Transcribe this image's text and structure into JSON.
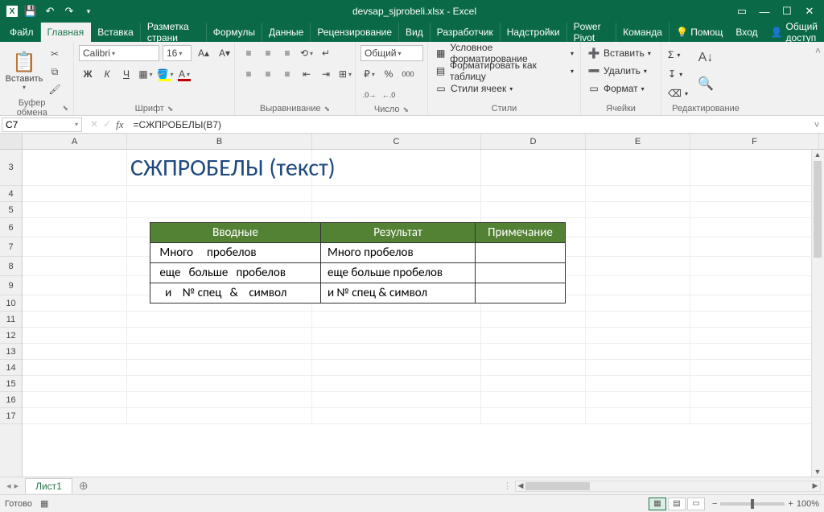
{
  "window": {
    "title": "devsap_sjprobeli.xlsx - Excel"
  },
  "qat": [
    "save",
    "undo",
    "redo",
    "reserved"
  ],
  "tabs": {
    "items": [
      "Файл",
      "Главная",
      "Вставка",
      "Разметка страни",
      "Формулы",
      "Данные",
      "Рецензирование",
      "Вид",
      "Разработчик",
      "Надстройки",
      "Power Pivot",
      "Команда"
    ],
    "active_index": 1,
    "help": "Помощ",
    "signin": "Вход",
    "share": "Общий доступ"
  },
  "ribbon": {
    "clipboard": {
      "title": "Буфер обмена",
      "paste": "Вставить"
    },
    "font": {
      "title": "Шрифт",
      "name": "Calibri",
      "size": "16"
    },
    "alignment": {
      "title": "Выравнивание"
    },
    "number": {
      "title": "Число",
      "format": "Общий"
    },
    "styles": {
      "title": "Стили",
      "conditional": "Условное форматирование",
      "astable": "Форматировать как таблицу",
      "cellstyles": "Стили ячеек"
    },
    "cells": {
      "title": "Ячейки",
      "insert": "Вставить",
      "delete": "Удалить",
      "format": "Формат"
    },
    "editing": {
      "title": "Редактирование"
    }
  },
  "formula_bar": {
    "namebox": "C7",
    "formula": "=СЖПРОБЕЛЫ(B7)"
  },
  "columns": [
    "A",
    "B",
    "C",
    "D",
    "E",
    "F"
  ],
  "visible_rows": [
    3,
    4,
    5,
    6,
    7,
    8,
    9,
    10,
    11,
    12,
    13,
    14,
    15,
    16,
    17
  ],
  "sheet": {
    "big_title": "СЖПРОБЕЛЫ (текст)",
    "headers": {
      "b": "Вводные",
      "c": "Результат",
      "d": "Примечание"
    },
    "rows": [
      {
        "b": " Много     пробелов",
        "c": "Много пробелов",
        "d": ""
      },
      {
        "b": " еще   больше   пробелов",
        "c": "еще больше пробелов",
        "d": ""
      },
      {
        "b": "   и    № спец   &    символ",
        "c": "и № спец & символ",
        "d": ""
      }
    ]
  },
  "sheet_tabs": {
    "active": "Лист1"
  },
  "statusbar": {
    "mode": "Готово",
    "zoom": "100%"
  }
}
